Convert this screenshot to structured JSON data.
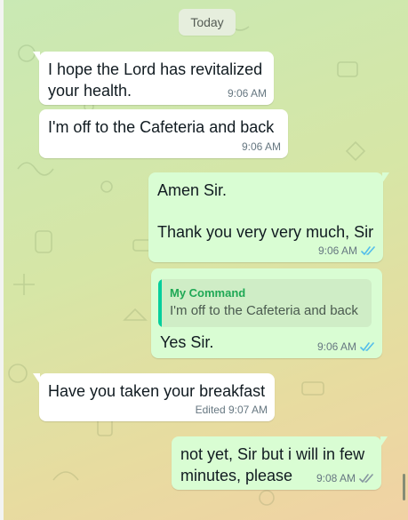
{
  "date_chip": "Today",
  "messages": [
    {
      "text": "I hope the Lord has revitalized\nyour health.",
      "time": "9:06 AM"
    },
    {
      "text": "I'm off to the Cafeteria and back",
      "time": "9:06 AM"
    },
    {
      "text": "Amen Sir.\n\nThank you very very much, Sir",
      "time": "9:06 AM",
      "status": "read"
    },
    {
      "quote_author": "My Command",
      "quote_text": "I'm off to the Cafeteria and back",
      "text": "Yes Sir.",
      "time": "9:06 AM",
      "status": "read"
    },
    {
      "text": "Have you taken your breakfast",
      "time": "Edited 9:07 AM"
    },
    {
      "text": "not yet, Sir but i will in few\nminutes, please",
      "time": "9:08 AM",
      "status": "delivered"
    }
  ],
  "colors": {
    "incoming": "#ffffff",
    "outgoing": "#d9fdd3",
    "read_ticks": "#53bdeb",
    "delivered_ticks": "#8696a0",
    "quote_accent": "#06cf9c",
    "quote_author": "#1fa855"
  },
  "icons": [
    "double-check-icon"
  ]
}
